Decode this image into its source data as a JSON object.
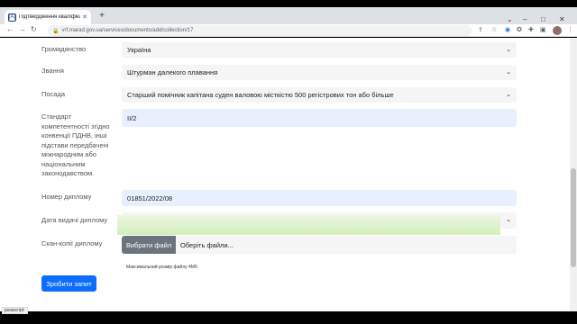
{
  "browser": {
    "tab_title": "Підтвердження кваліфікації м...",
    "tab_icon": "[A]",
    "new_tab": "+",
    "url": "vrf.marad.gov.ua/services/documents/add/collection/17",
    "window_controls": {
      "minimize": "–",
      "maximize": "□",
      "close": "✕"
    },
    "status_bar": "javascript:"
  },
  "form": {
    "citizenship": {
      "label": "Громадянство",
      "value": "Україна"
    },
    "rank": {
      "label": "Звання",
      "value": "Штурман далекого плавання"
    },
    "position": {
      "label": "Посада",
      "value": "Старший помічник капітана суден валовою місткістю 500 регістрових тон або більше"
    },
    "standard": {
      "label": "Стандарт компетентності згідно конвенції ПДНВ, інші підстави передбачені міжнародним або національним законодавством.",
      "value": "II/2"
    },
    "diploma_number": {
      "label": "Номер диплому",
      "value": "01851/2022/08"
    },
    "issue_date": {
      "label": "Дата видачі диплому",
      "value": ""
    },
    "scan": {
      "label": "Скан-копії диплому",
      "button": "Вибрати файл",
      "placeholder": "Оберіть файли..."
    },
    "hint": "Максимальний розмір файлу 4Мб",
    "submit": "Зробити запит"
  },
  "icons": [
    "back-icon",
    "forward-icon",
    "reload-icon",
    "lock-icon",
    "share-icon",
    "star-icon",
    "extension-icon",
    "puzzle-icon",
    "sidebar-icon",
    "avatar",
    "menu-icon",
    "chevron-down-icon"
  ]
}
